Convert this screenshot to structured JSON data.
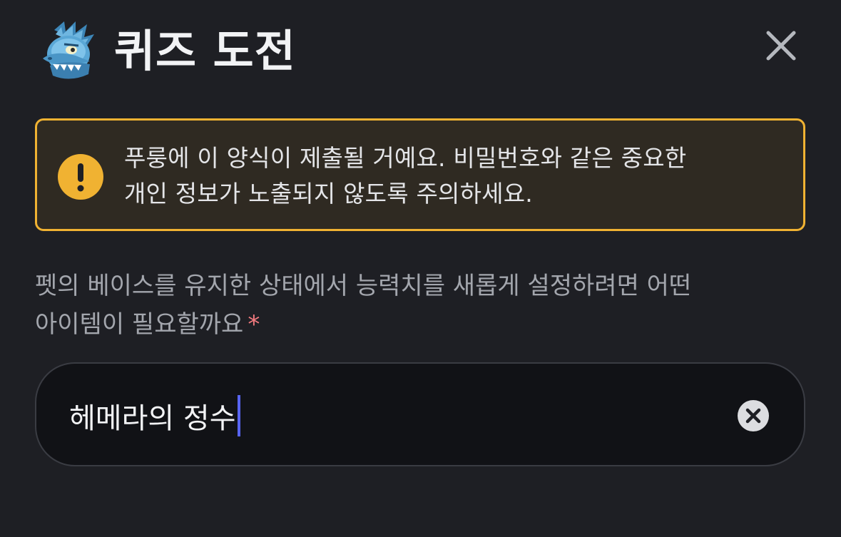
{
  "header": {
    "title": "퀴즈 도전",
    "app_icon": "dragon-mascot-icon",
    "close_icon": "close-icon"
  },
  "warning": {
    "icon": "exclamation-circle-icon",
    "line1": "푸룽에 이 양식이 제출될 거예요. 비밀번호와 같은 중요한",
    "line2": "개인 정보가 노출되지 않도록 주의하세요."
  },
  "question": {
    "line1": "펫의 베이스를 유지한 상태에서 능력치를 새롭게 설정하려면 어떤",
    "line2": "아이템이 필요할까요",
    "required_mark": "*"
  },
  "answer": {
    "value": "헤메라의 정수",
    "clear_icon": "clear-circle-icon"
  },
  "colors": {
    "background": "#1e1f24",
    "warning_border": "#f0b232",
    "warning_bg": "#2f2a22",
    "caret": "#5865f2",
    "required": "#f27a7f"
  }
}
